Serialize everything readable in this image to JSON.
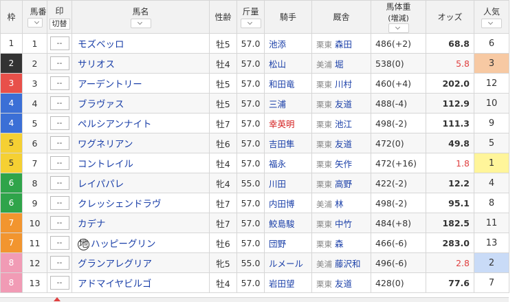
{
  "headers": {
    "waku": "枠",
    "umaban": "馬番",
    "mark": "印",
    "mark_toggle": "切替",
    "name": "馬名",
    "sexage": "性齢",
    "kinryo": "斤量",
    "jockey": "騎手",
    "trainer": "厩舎",
    "weight": "馬体重",
    "weight_sub": "(増減)",
    "odds": "オッズ",
    "pop": "人気"
  },
  "mark_placeholder": "--",
  "waku_colors": {
    "1": {
      "bg": "#ffffff",
      "fg": "#333333"
    },
    "2": {
      "bg": "#333333",
      "fg": "#ffffff"
    },
    "3": {
      "bg": "#e8504a",
      "fg": "#ffffff"
    },
    "4": {
      "bg": "#3b6fd6",
      "fg": "#ffffff"
    },
    "5": {
      "bg": "#f5d033",
      "fg": "#333333"
    },
    "6": {
      "bg": "#2fa44a",
      "fg": "#ffffff"
    },
    "7": {
      "bg": "#f2952f",
      "fg": "#ffffff"
    },
    "8": {
      "bg": "#f19bb5",
      "fg": "#ffffff"
    }
  },
  "pop_highlight": {
    "1": "#fff59a",
    "2": "#c9dbf7",
    "3": "#f7c9a3"
  },
  "rows": [
    {
      "waku": "1",
      "umaban": "1",
      "name": "モズベッロ",
      "chi": false,
      "sexage": "牡5",
      "kinryo": "57.0",
      "jockey": "池添",
      "jockey_hl": false,
      "area": "栗東",
      "trainer": "森田",
      "weight": "486(+2)",
      "odds": "68.8",
      "fav": false,
      "pop": "6"
    },
    {
      "waku": "2",
      "umaban": "2",
      "name": "サリオス",
      "chi": false,
      "sexage": "牡4",
      "kinryo": "57.0",
      "jockey": "松山",
      "jockey_hl": false,
      "area": "美浦",
      "trainer": "堀",
      "weight": "538(0)",
      "odds": "5.8",
      "fav": true,
      "pop": "3"
    },
    {
      "waku": "3",
      "umaban": "3",
      "name": "アーデントリー",
      "chi": false,
      "sexage": "牡5",
      "kinryo": "57.0",
      "jockey": "和田竜",
      "jockey_hl": false,
      "area": "栗東",
      "trainer": "川村",
      "weight": "460(+4)",
      "odds": "202.0",
      "fav": false,
      "pop": "12"
    },
    {
      "waku": "4",
      "umaban": "4",
      "name": "ブラヴァス",
      "chi": false,
      "sexage": "牡5",
      "kinryo": "57.0",
      "jockey": "三浦",
      "jockey_hl": false,
      "area": "栗東",
      "trainer": "友道",
      "weight": "488(-4)",
      "odds": "112.9",
      "fav": false,
      "pop": "10"
    },
    {
      "waku": "4",
      "umaban": "5",
      "name": "ペルシアンナイト",
      "chi": false,
      "sexage": "牡7",
      "kinryo": "57.0",
      "jockey": "幸英明",
      "jockey_hl": true,
      "area": "栗東",
      "trainer": "池江",
      "weight": "498(-2)",
      "odds": "111.3",
      "fav": false,
      "pop": "9"
    },
    {
      "waku": "5",
      "umaban": "6",
      "name": "ワグネリアン",
      "chi": false,
      "sexage": "牡6",
      "kinryo": "57.0",
      "jockey": "吉田隼",
      "jockey_hl": false,
      "area": "栗東",
      "trainer": "友道",
      "weight": "472(0)",
      "odds": "49.8",
      "fav": false,
      "pop": "5"
    },
    {
      "waku": "5",
      "umaban": "7",
      "name": "コントレイル",
      "chi": false,
      "sexage": "牡4",
      "kinryo": "57.0",
      "jockey": "福永",
      "jockey_hl": false,
      "area": "栗東",
      "trainer": "矢作",
      "weight": "472(+16)",
      "odds": "1.8",
      "fav": true,
      "pop": "1"
    },
    {
      "waku": "6",
      "umaban": "8",
      "name": "レイパパレ",
      "chi": false,
      "sexage": "牝4",
      "kinryo": "55.0",
      "jockey": "川田",
      "jockey_hl": false,
      "area": "栗東",
      "trainer": "高野",
      "weight": "422(-2)",
      "odds": "12.2",
      "fav": false,
      "pop": "4"
    },
    {
      "waku": "6",
      "umaban": "9",
      "name": "クレッシェンドラヴ",
      "chi": false,
      "sexage": "牡7",
      "kinryo": "57.0",
      "jockey": "内田博",
      "jockey_hl": false,
      "area": "美浦",
      "trainer": "林",
      "weight": "498(-2)",
      "odds": "95.1",
      "fav": false,
      "pop": "8"
    },
    {
      "waku": "7",
      "umaban": "10",
      "name": "カデナ",
      "chi": false,
      "sexage": "牡7",
      "kinryo": "57.0",
      "jockey": "鮫島駿",
      "jockey_hl": false,
      "area": "栗東",
      "trainer": "中竹",
      "weight": "484(+8)",
      "odds": "182.5",
      "fav": false,
      "pop": "11"
    },
    {
      "waku": "7",
      "umaban": "11",
      "name": "ハッピーグリン",
      "chi": true,
      "chi_label": "地",
      "sexage": "牡6",
      "kinryo": "57.0",
      "jockey": "団野",
      "jockey_hl": false,
      "area": "栗東",
      "trainer": "森",
      "weight": "466(-6)",
      "odds": "283.0",
      "fav": false,
      "pop": "13"
    },
    {
      "waku": "8",
      "umaban": "12",
      "name": "グランアレグリア",
      "chi": false,
      "sexage": "牝5",
      "kinryo": "55.0",
      "jockey": "ルメール",
      "jockey_hl": false,
      "area": "美浦",
      "trainer": "藤沢和",
      "weight": "496(-6)",
      "odds": "2.8",
      "fav": true,
      "pop": "2"
    },
    {
      "waku": "8",
      "umaban": "13",
      "name": "アドマイヤビルゴ",
      "chi": false,
      "sexage": "牡4",
      "kinryo": "57.0",
      "jockey": "岩田望",
      "jockey_hl": false,
      "area": "栗東",
      "trainer": "友道",
      "weight": "428(0)",
      "odds": "77.6",
      "fav": false,
      "pop": "7"
    }
  ]
}
